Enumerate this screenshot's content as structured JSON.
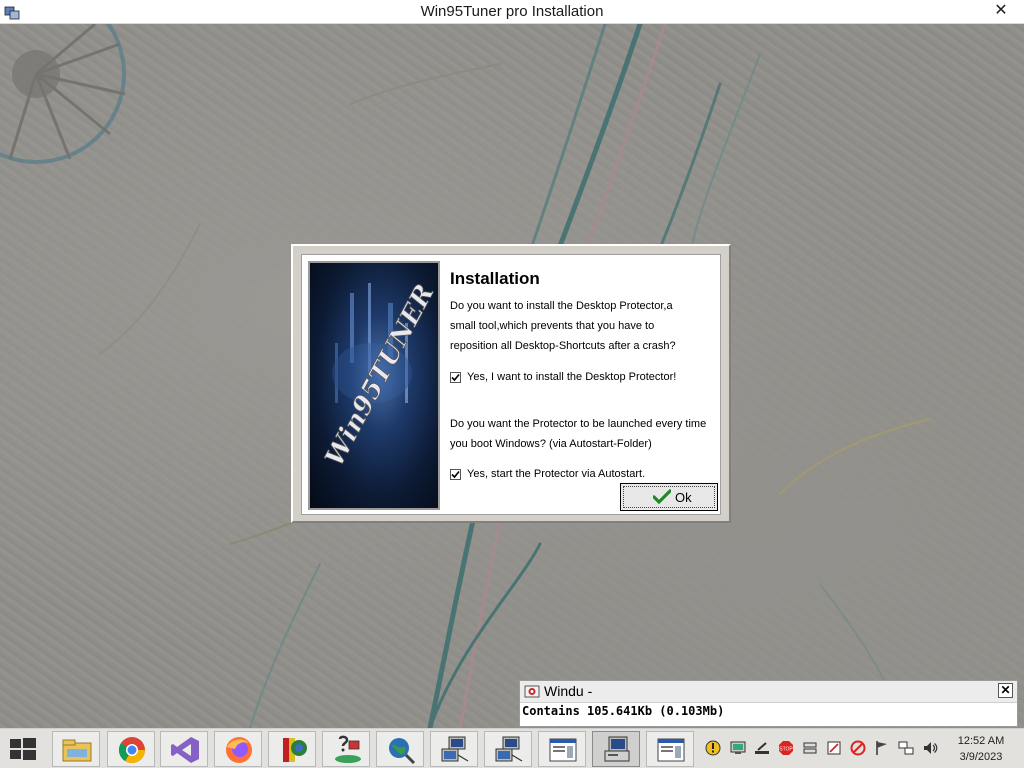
{
  "window": {
    "title": "Win95Tuner pro Installation",
    "close_glyph": "✕"
  },
  "dialog": {
    "title": "Installation",
    "question1_lines": [
      "Do you want to install the Desktop Protector,a",
      "small tool,which prevents that you have to",
      "reposition all Desktop-Shortcuts after a crash?"
    ],
    "checkbox1": {
      "label": "Yes, I want to install the Desktop Protector!",
      "checked": true
    },
    "question2_lines": [
      "Do you want the Protector to be launched every time",
      "you boot Windows? (via Autostart-Folder)"
    ],
    "checkbox2": {
      "label": "Yes, start the Protector via Autostart.",
      "checked": true
    },
    "ok_label": "Ok",
    "banner_text": "Win95TUNER"
  },
  "windu": {
    "title": "Windu -",
    "status": "Contains 105.641Kb (0.103Mb)",
    "close_glyph": "✕"
  },
  "taskbar": {
    "clock_time": "12:52 AM",
    "clock_date": "3/9/2023",
    "buttons": [
      "file-explorer-icon",
      "chrome-icon",
      "visual-studio-icon",
      "firefox-icon",
      "app-icon",
      "setup-icon",
      "search-globe-icon",
      "network-computer-icon",
      "network-computer-icon-2",
      "window-app-icon",
      "installer-icon",
      "window-app-icon-2"
    ],
    "tray_icons": [
      "info-icon",
      "monitor-icon",
      "tool-icon",
      "stop-icon",
      "drive-icon",
      "edit-icon",
      "no-entry-icon",
      "flag-icon",
      "network-icon",
      "volume-icon"
    ]
  },
  "colors": {
    "dialog_face": "#d4d0c8",
    "banner_blue": "#1e3a6a",
    "ok_check_green": "#1c8a2a"
  }
}
